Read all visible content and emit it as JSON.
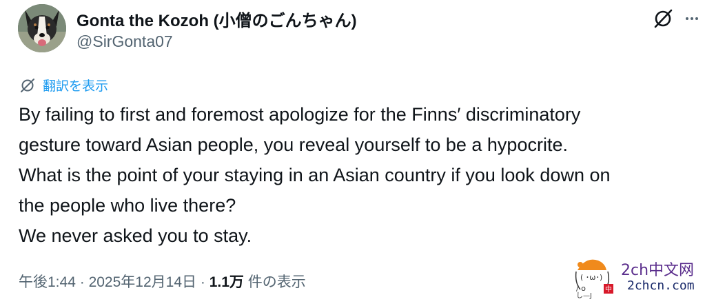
{
  "author": {
    "display_name": "Gonta the Kozoh (小僧のごんちゃん)",
    "handle": "@SirGonta07",
    "avatar_icon": "dog-avatar"
  },
  "actions": {
    "grok_icon": "grok-icon",
    "more_icon": "more-dots-icon"
  },
  "translate": {
    "label": "翻訳を表示"
  },
  "tweet": {
    "lines": [
      "By failing to first  and foremost apologize for the Finns′ discriminatory",
      "gesture toward Asian people, you reveal yourself to be a hypocrite.",
      "What is the point of your staying in an Asian country if you look down on",
      "the people who live there?",
      "We never asked you to stay."
    ]
  },
  "meta": {
    "time": "午後1:44",
    "separator": "·",
    "date": "2025年12月14日",
    "views_count": "1.1万",
    "views_label": "件の表示"
  },
  "watermark": {
    "site_cn": "2ch中文网",
    "site_url": "2chcn.com"
  },
  "colors": {
    "link_blue": "#1d9bf0",
    "text_primary": "#0f1419",
    "text_secondary": "#536471"
  }
}
